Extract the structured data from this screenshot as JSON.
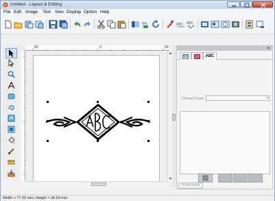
{
  "window": {
    "title": "Untitled - Layout & Editing"
  },
  "menu": [
    "File",
    "Edit",
    "Image",
    "Text",
    "Sew",
    "Display",
    "Option",
    "Help"
  ],
  "toolbar_icons": [
    "new-file-icon",
    "open-folder-icon",
    "import-icon",
    "export-icon",
    "save-icon",
    "save-as-icon",
    "undo-icon",
    "redo-icon",
    "cut-icon",
    "copy-icon",
    "paste-icon",
    "flip-icon",
    "rotate-icon",
    "refresh-icon",
    "select-color-icon",
    "text-attribute-icon",
    "text-spacing-icon",
    "design-page-icon",
    "hoop-icon",
    "image-icon",
    "preview-icon",
    "realistic-preview-icon",
    "write-card-icon"
  ],
  "tools": [
    "select-icon",
    "point-edit-icon",
    "zoom-icon",
    "text-icon",
    "shape-icon",
    "outline-icon",
    "fill-icon",
    "stamp-icon",
    "bucket-icon",
    "brush-icon",
    "ruler-icon",
    "import-pattern-icon"
  ],
  "ruler": {
    "marks": [
      "50",
      "0",
      "50"
    ]
  },
  "panel": {
    "tabs": [
      "sew-attributes-tab",
      "colors-tab",
      "ABC"
    ],
    "abc_label": "ABC",
    "thread_chart_label": "Thread Chart:",
    "thread_chart_value": "",
    "to_list_label": "To list mode"
  },
  "status": {
    "text": "Width = 77.60 mm, Height = 30.00 mm"
  }
}
